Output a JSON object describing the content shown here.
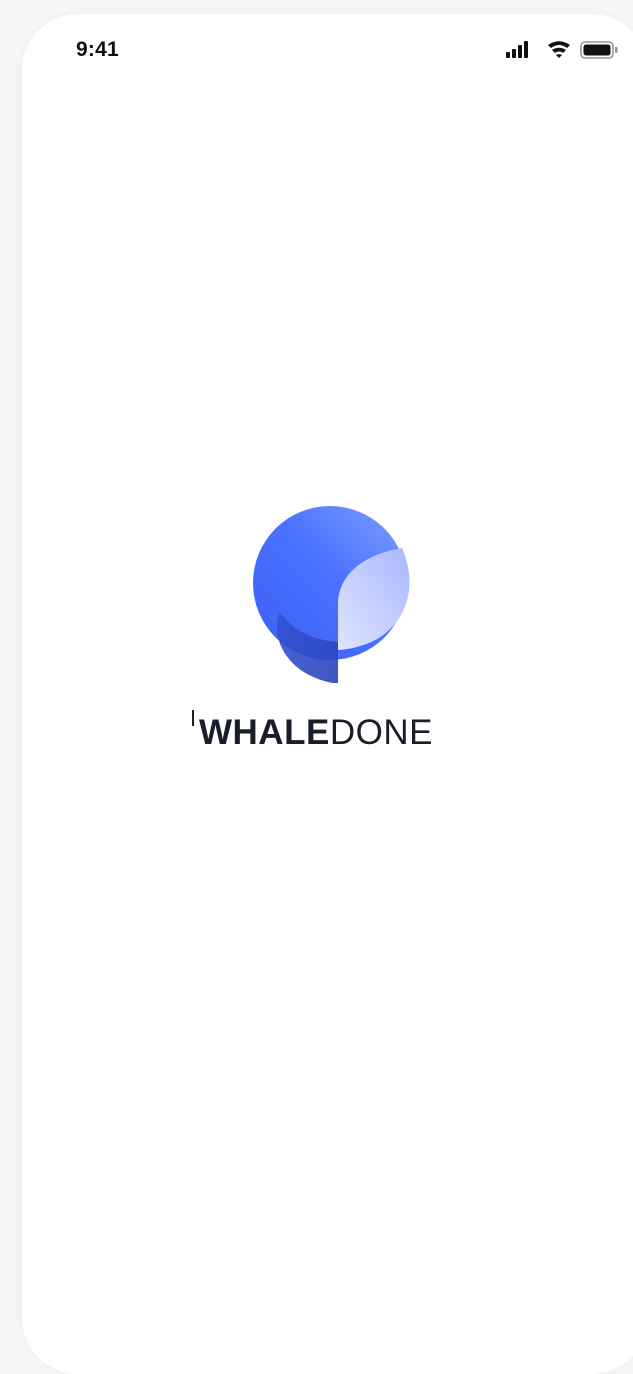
{
  "status_bar": {
    "time": "9:41",
    "icons": [
      "signal-icon",
      "wifi-icon",
      "battery-icon"
    ]
  },
  "logo": {
    "icon": "whaledone-logo-icon",
    "word_bold": "WHALE",
    "word_light": "DONE",
    "colors": {
      "primary_blue": "#3d63f5",
      "light_blue": "#b9c4ff",
      "dark_blue": "#2f49c4",
      "wordmark": "#1a1d2a"
    }
  },
  "colors": {
    "background": "#f5f6f8",
    "screen": "#ffffff"
  }
}
